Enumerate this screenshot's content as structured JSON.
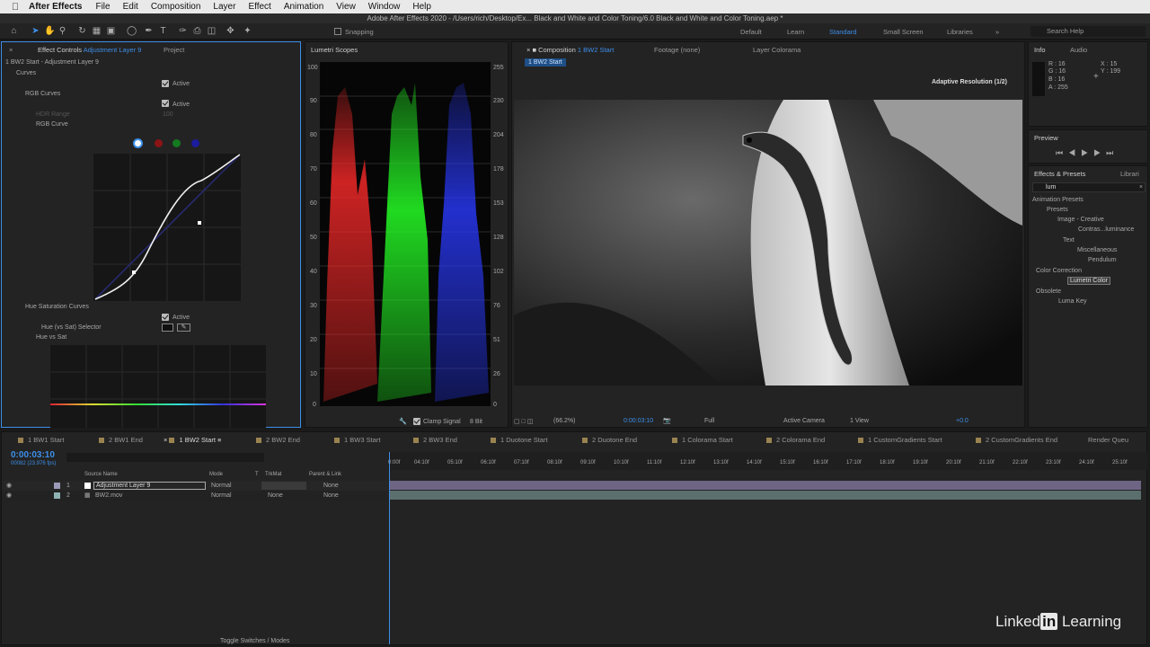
{
  "menubar": {
    "app": "After Effects",
    "items": [
      "File",
      "Edit",
      "Composition",
      "Layer",
      "Effect",
      "Animation",
      "View",
      "Window",
      "Help"
    ]
  },
  "title": "Adobe After Effects 2020 - /Users/rich/Desktop/Ex... Black and White and Color Toning/6.0 Black and White and Color Toning.aep *",
  "toolbar": {
    "snapping": "Snapping",
    "workspaces": [
      "Default",
      "Learn",
      "Standard",
      "Small Screen",
      "Libraries"
    ],
    "active_workspace": "Standard",
    "search_placeholder": "Search Help"
  },
  "effect_controls": {
    "tab_prefix": "Effect Controls",
    "tab_layer": "Adjustment Layer 9",
    "project_tab": "Project",
    "header": "1 BW2 Start - Adjustment Layer 9",
    "curves": "Curves",
    "active": "Active",
    "rgb_curves": "RGB Curves",
    "hdr_range": "HDR Range",
    "hdr_value": "100",
    "rgb_curve": "RGB Curve",
    "hue_sat_curves": "Hue Saturation Curves",
    "hue_sat_selector": "Hue (vs Sat) Selector",
    "hue_vs_sat": "Hue vs Sat"
  },
  "lumetri": {
    "tab": "Lumetri Scopes",
    "left_ticks": [
      "100",
      "90",
      "80",
      "70",
      "60",
      "50",
      "40",
      "30",
      "20",
      "10",
      "0"
    ],
    "right_ticks": [
      "255",
      "230",
      "204",
      "178",
      "153",
      "128",
      "102",
      "76",
      "51",
      "26",
      "0"
    ],
    "clamp": "Clamp Signal",
    "bits": "8 Bit"
  },
  "comp": {
    "tab_prefix": "Composition",
    "tab_name": "1 BW2 Start",
    "footage": "Footage (none)",
    "layer": "Layer Colorama",
    "crumb": "1 BW2 Start",
    "adaptive": "Adaptive Resolution (1/2)",
    "zoom": "(66.2%)",
    "time": "0:00:03:10",
    "resolution": "Full",
    "camera": "Active Camera",
    "view": "1 View",
    "exposure": "+0.0"
  },
  "info": {
    "tab": "Info",
    "audio": "Audio",
    "r": "R : 16",
    "g": "G : 16",
    "b": "B : 16",
    "a": "A : 255",
    "x": "X : 15",
    "y": "Y : 199"
  },
  "preview": {
    "tab": "Preview"
  },
  "effects": {
    "tab": "Effects & Presets",
    "libraries": "Librari",
    "search": "lum",
    "tree": [
      "Animation Presets",
      "Presets",
      "Image - Creative",
      "Contras...luminance",
      "Text",
      "Miscellaneous",
      "Pendulum",
      "Color Correction",
      "Lumetri Color",
      "Obsolete",
      "Luma Key"
    ]
  },
  "timeline": {
    "tabs": [
      "1 BW1 Start",
      "2 BW1 End",
      "1 BW2 Start",
      "2 BW2 End",
      "1 BW3 Start",
      "2 BW3 End",
      "1 Duotone Start",
      "2 Duotone End",
      "1 Colorama Start",
      "2 Colorama End",
      "1 CustomGradients Start",
      "2 CustomGradients End",
      "Render Queu"
    ],
    "timecode": "0:00:03:10",
    "fps": "00082 (23.976 fps)",
    "col_source": "Source Name",
    "col_mode": "Mode",
    "col_t": "T",
    "col_trkmat": "TrkMat",
    "col_parent": "Parent & Link",
    "layers": [
      {
        "num": "1",
        "name": "Adjustment Layer 9",
        "mode": "Normal",
        "trkmat": "",
        "parent": "None"
      },
      {
        "num": "2",
        "name": "BW2.mov",
        "mode": "Normal",
        "trkmat": "None",
        "parent": "None"
      }
    ],
    "ruler": [
      "0:00f",
      "04:10f",
      "05:10f",
      "06:10f",
      "07:10f",
      "08:10f",
      "09:10f",
      "10:10f",
      "11:10f",
      "12:10f",
      "13:10f",
      "14:10f",
      "15:10f",
      "16:10f",
      "17:10f",
      "18:10f",
      "19:10f",
      "20:10f",
      "21:10f",
      "22:10f",
      "23:10f",
      "24:10f",
      "25:10f"
    ],
    "toggle": "Toggle Switches / Modes"
  },
  "watermark": {
    "brand_a": "Linked",
    "brand_b": "in",
    "brand_c": " Learning"
  }
}
